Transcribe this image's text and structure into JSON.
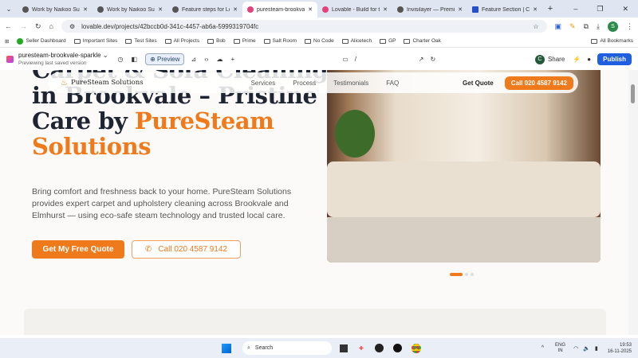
{
  "browser": {
    "tabs": [
      {
        "label": "Work by Naikoo Suh"
      },
      {
        "label": "Work by Naikoo Suh"
      },
      {
        "label": "Feature steps for Lov"
      },
      {
        "label": "puresteam-brookval"
      },
      {
        "label": "Lovable - Build for t"
      },
      {
        "label": "Invisilayer — Premiu"
      },
      {
        "label": "Feature Section | Co"
      }
    ],
    "url": "lovable.dev/projects/42bccb0d-341c-4457-ab6a-5999319704fc",
    "profile": "S",
    "bookmarks": [
      "Seller Dashboard",
      "Important Sites",
      "Test Sites",
      "All Projects",
      "Bob",
      "Prime",
      "Salt Room",
      "No Code",
      "Alicetech",
      "GP",
      "Charter Oak"
    ],
    "all_bookmarks": "All Bookmarks"
  },
  "lovable": {
    "project": "puresteam-brookvale-sparkle",
    "subtitle": "Previewing last saved version",
    "preview": "Preview",
    "path": "/",
    "share": "Share",
    "publish": "Publish",
    "avatar": "C"
  },
  "site": {
    "brand": "PureSteam Solutions",
    "nav": [
      "Services",
      "Process",
      "Testimonials",
      "FAQ"
    ],
    "get_quote": "Get Quote",
    "call_nav": "Call 020 4587 9142",
    "h1_line1": "Carpet & Sofa Cleaning",
    "h1_line2": "in Brookvale – Pristine",
    "h1_line3a": "Care by ",
    "h1_line3b": "PureSteam",
    "h1_line4": "Solutions",
    "description": "Bring comfort and freshness back to your home. PureSteam Solutions provides expert carpet and upholstery cleaning across Brookvale and Elmhurst — using eco-safe steam technology and trusted local care.",
    "cta_primary": "Get My Free Quote",
    "cta_call": "Call 020 4587 9142"
  },
  "taskbar": {
    "search": "Search",
    "lang1": "ENG",
    "lang2": "IN",
    "time": "19:53",
    "date": "16-11-2025"
  }
}
